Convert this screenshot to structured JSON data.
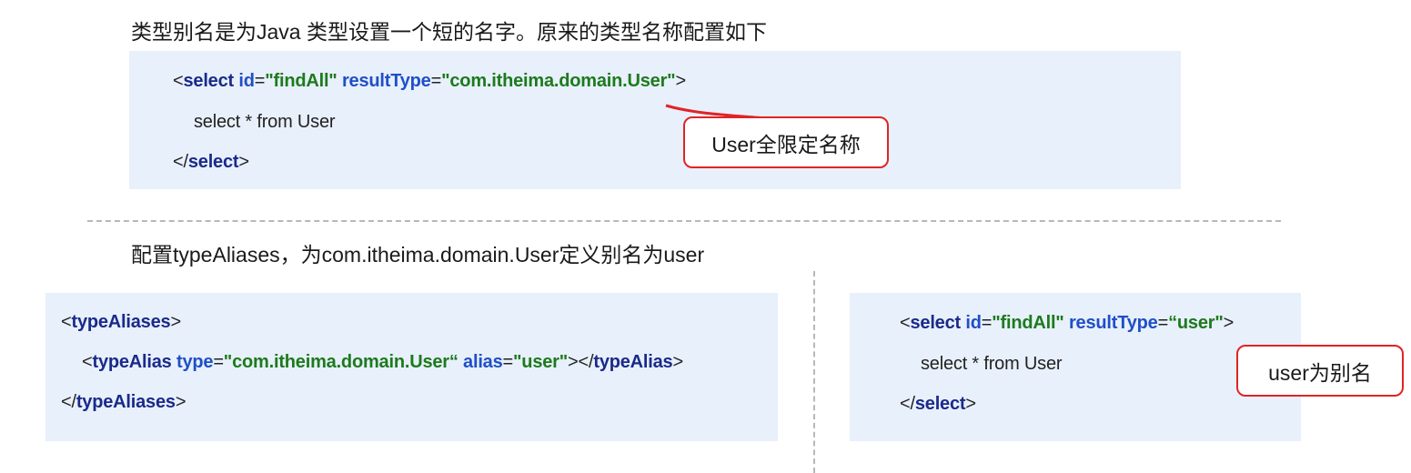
{
  "intro_text": "类型别名是为Java 类型设置一个短的名字。原来的类型名称配置如下",
  "original_code": {
    "line1": {
      "open": "<",
      "tag": "select",
      "attr1": " id",
      "eq1": "=",
      "val1": "\"findAll\"",
      "attr2": " resultType",
      "eq2": "=",
      "val2": "\"com.itheima.domain.User\"",
      "close": ">"
    },
    "line2": "select * from User",
    "line3": {
      "open": "</",
      "tag": "select",
      "close": ">"
    }
  },
  "callout_full_name": "User全限定名称",
  "config_text": "配置typeAliases，为com.itheima.domain.User定义别名为user",
  "alias_code": {
    "line1": {
      "open": "<",
      "tag": "typeAliases",
      "close": ">"
    },
    "line2": {
      "open": "<",
      "tag": "typeAlias",
      "attr1": " type",
      "eq1": "=",
      "val1": "\"com.itheima.domain.User“",
      "attr2": " alias",
      "eq2": "=",
      "val2": "\"user\"",
      "close1": "></",
      "tag2": "typeAlias",
      "close2": ">"
    },
    "line3": {
      "open": "</",
      "tag": "typeAliases",
      "close": ">"
    }
  },
  "alias_usage_code": {
    "line1": {
      "open": "<",
      "tag": "select",
      "attr1": " id",
      "eq1": "=",
      "val1": "\"findAll\"",
      "attr2": " resultType",
      "eq2": "=",
      "val2": "“user\"",
      "close": ">"
    },
    "line2": "select * from User",
    "line3": {
      "open": "</",
      "tag": "select",
      "close": ">"
    }
  },
  "callout_alias": "user为别名",
  "colors": {
    "code_bg": "#e8f0fb",
    "callout_border": "#e02424",
    "tag": "#1a2a8a",
    "attribute": "#1f4fc8",
    "string": "#1d7a1d"
  }
}
